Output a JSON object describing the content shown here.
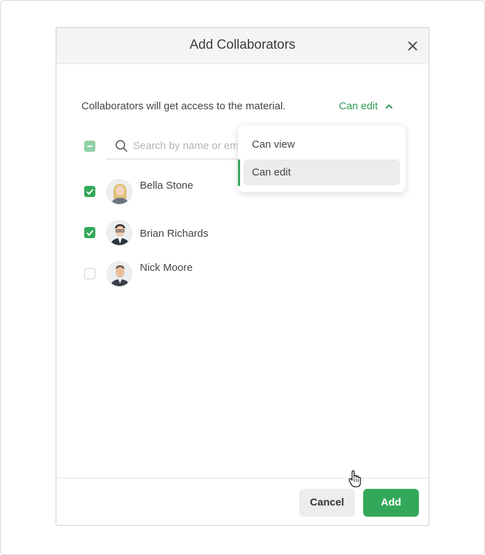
{
  "dialog": {
    "title": "Add Collaborators",
    "info_text": "Collaborators will get access to the material.",
    "permission_toggle_label": "Can edit"
  },
  "search": {
    "placeholder": "Search by name or email",
    "value": ""
  },
  "people": [
    {
      "name": "Bella Stone",
      "checked": true
    },
    {
      "name": "Brian Richards",
      "checked": true
    },
    {
      "name": "Nick Moore",
      "checked": false
    }
  ],
  "dropdown": {
    "options": [
      "Can view",
      "Can edit"
    ],
    "selected": "Can edit"
  },
  "footer": {
    "cancel_label": "Cancel",
    "add_label": "Add"
  },
  "colors": {
    "accent": "#34a85a",
    "accent_light": "#8fd1a5",
    "link_green": "#2f9a55"
  }
}
